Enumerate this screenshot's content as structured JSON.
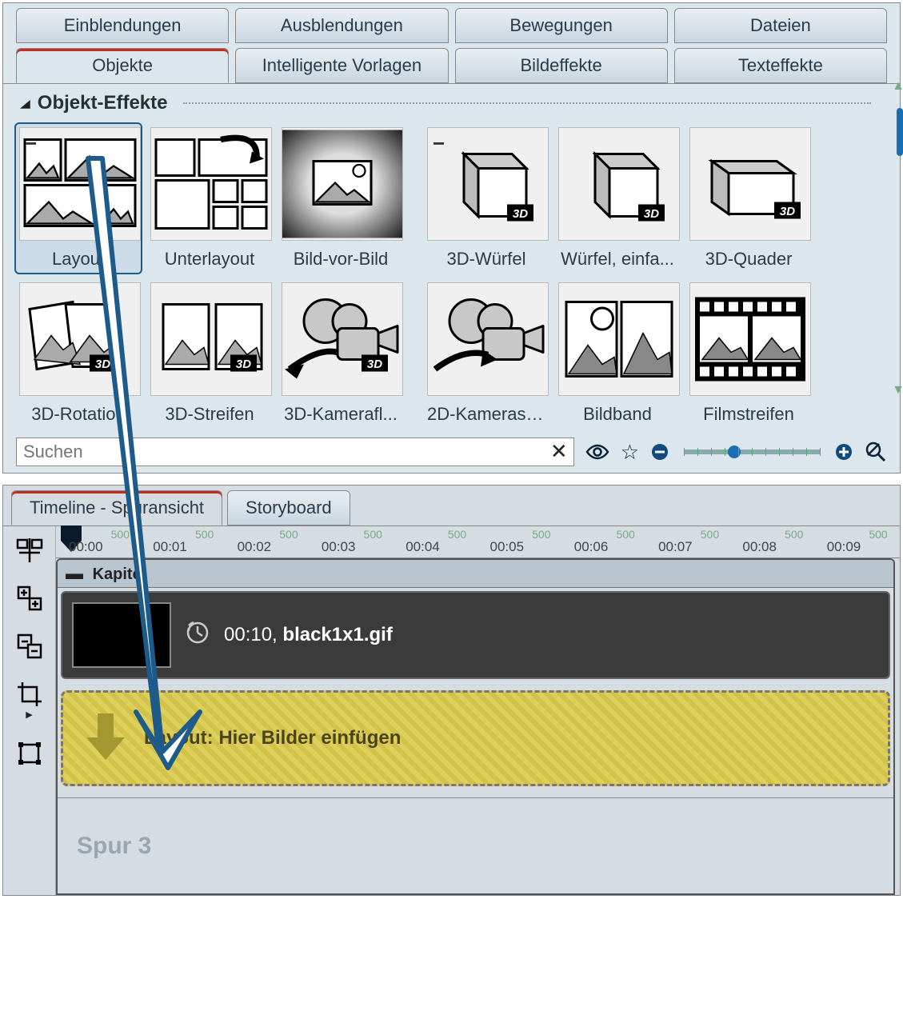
{
  "primary_tabs": [
    "Einblendungen",
    "Ausblendungen",
    "Bewegungen",
    "Dateien"
  ],
  "secondary_tabs": [
    "Objekte",
    "Intelligente Vorlagen",
    "Bildeffekte",
    "Texteffekte"
  ],
  "secondary_active": 0,
  "section_title": "Objekt-Effekte",
  "effects": [
    {
      "label": "Layout",
      "selected": true
    },
    {
      "label": "Unterlayout"
    },
    {
      "label": "Bild-vor-Bild"
    },
    {
      "label": "3D-Würfel"
    },
    {
      "label": "Würfel, einfa..."
    },
    {
      "label": "3D-Quader"
    },
    {
      "label": "3D-Rotation"
    },
    {
      "label": "3D-Streifen"
    },
    {
      "label": "3D-Kamerafl..."
    },
    {
      "label": "2D-Kamerasc..."
    },
    {
      "label": "Bildband"
    },
    {
      "label": "Filmstreifen"
    }
  ],
  "search_placeholder": "Suchen",
  "timeline_tabs": [
    "Timeline - Spuransicht",
    "Storyboard"
  ],
  "timeline_active": 0,
  "ruler_major": [
    "00:00",
    "00:01",
    "00:02",
    "00:03",
    "00:04",
    "00:05",
    "00:06",
    "00:07",
    "00:08",
    "00:09"
  ],
  "ruler_minor_label": "500",
  "chapter_label": "Kapitel",
  "clip": {
    "duration": "00:10, ",
    "filename": "black1x1.gif"
  },
  "dropzone_label": "Layout: Hier Bilder einfügen",
  "track3_label": "Spur 3"
}
